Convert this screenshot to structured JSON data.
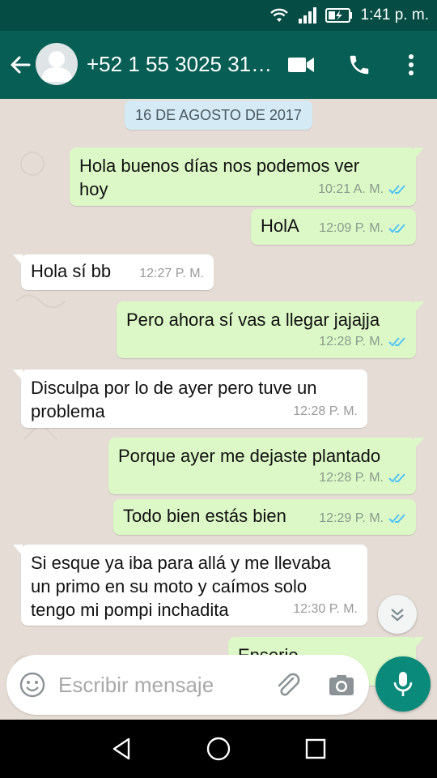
{
  "status_bar": {
    "time": "1:41 p. m."
  },
  "app_bar": {
    "contact_name": "+52 1 55 3025 31…",
    "back_icon": "arrow-back-icon",
    "video_icon": "videocam-icon",
    "call_icon": "phone-icon",
    "menu_icon": "more-vert-icon"
  },
  "chat": {
    "date_label": "16 DE AGOSTO DE 2017",
    "messages": [
      {
        "direction": "out",
        "text": "Hola buenos días nos podemos ver\nhoy",
        "time": "10:21 A. M.",
        "read": true
      },
      {
        "direction": "out",
        "text": "HolA",
        "time": "12:09 P. M.",
        "read": true
      },
      {
        "direction": "in",
        "text": "Hola sí bb",
        "time": "12:27 P. M."
      },
      {
        "direction": "out",
        "text": "Pero ahora sí vas a llegar jajajja",
        "time": "12:28 P. M.",
        "read": true
      },
      {
        "direction": "in",
        "text": "Disculpa por lo de ayer pero tuve un\nproblema",
        "time": "12:28 P. M."
      },
      {
        "direction": "out",
        "text": "Porque ayer me dejaste plantado",
        "time": "12:28 P. M.",
        "read": true
      },
      {
        "direction": "out",
        "text": "Todo bien estás bien",
        "time": "12:29 P. M.",
        "read": true
      },
      {
        "direction": "in",
        "text": "Si esque ya iba para allá y me llevaba\nun primo en su moto y caímos solo\ntengo mi pompi inchadita",
        "time": "12:30 P. M."
      },
      {
        "direction": "out",
        "text": "Enserio",
        "time": ""
      }
    ]
  },
  "composer": {
    "placeholder": "Escribir mensaje"
  },
  "colors": {
    "header": "#075e54",
    "status_bar": "#054d44",
    "outgoing_bubble": "#dcf8c6",
    "incoming_bubble": "#ffffff",
    "chat_background": "#e5ddd5",
    "read_ticks": "#4fc3f7",
    "mic_button": "#0a8a7a"
  }
}
